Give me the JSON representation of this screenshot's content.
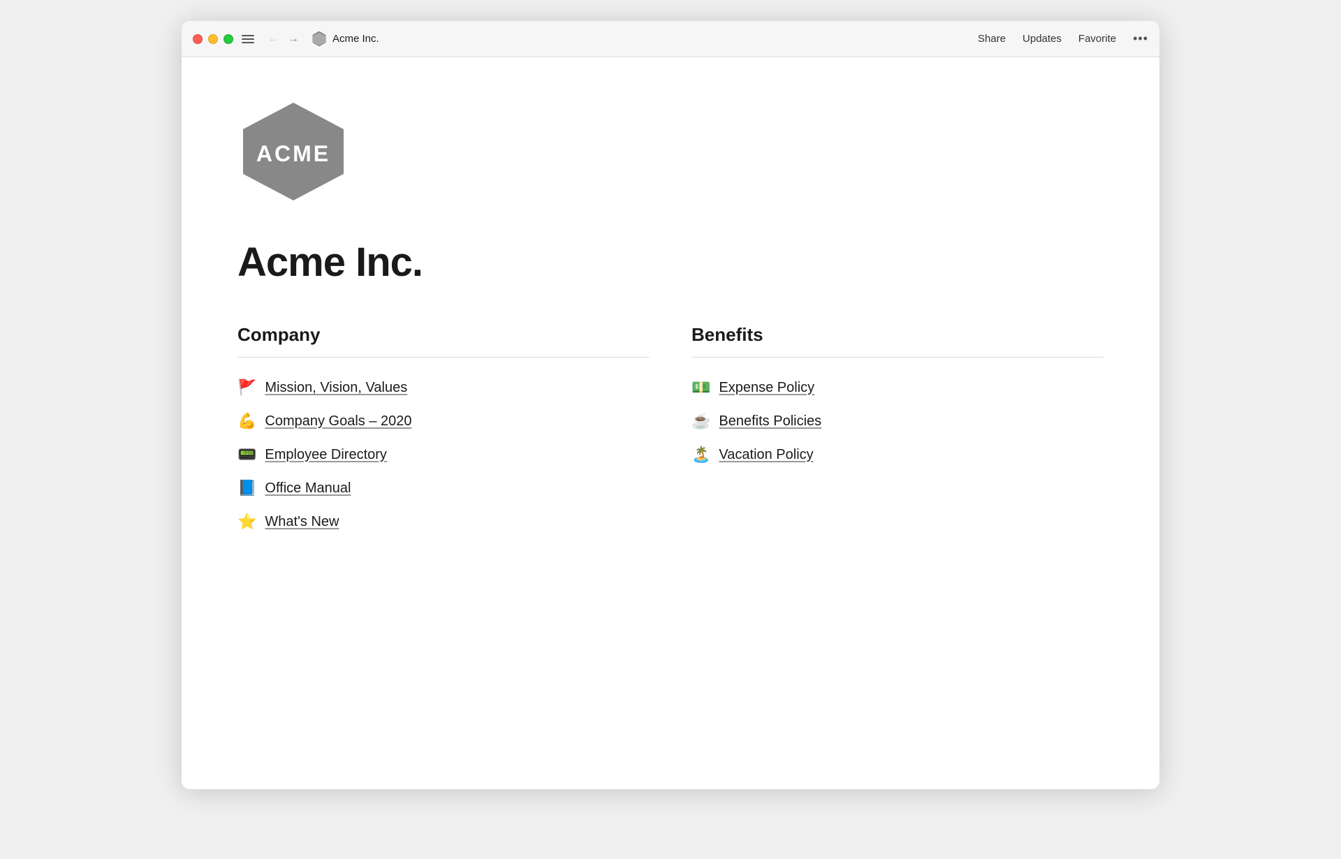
{
  "window": {
    "title": "Acme Inc.",
    "traffic_lights": {
      "close_label": "close",
      "minimize_label": "minimize",
      "maximize_label": "maximize"
    }
  },
  "titlebar": {
    "back_arrow": "←",
    "forward_arrow": "→",
    "page_title": "Acme Inc.",
    "actions": {
      "share": "Share",
      "updates": "Updates",
      "favorite": "Favorite",
      "more": "•••"
    }
  },
  "page": {
    "heading": "Acme Inc.",
    "logo_alt": "Acme Inc. Logo"
  },
  "company_section": {
    "heading": "Company",
    "items": [
      {
        "emoji": "🚩",
        "label": "Mission, Vision, Values"
      },
      {
        "emoji": "💪",
        "label": "Company Goals – 2020"
      },
      {
        "emoji": "📟",
        "label": "Employee Directory"
      },
      {
        "emoji": "📘",
        "label": "Office Manual"
      },
      {
        "emoji": "⭐",
        "label": "What's New"
      }
    ]
  },
  "benefits_section": {
    "heading": "Benefits",
    "items": [
      {
        "emoji": "💵",
        "label": "Expense Policy"
      },
      {
        "emoji": "☕",
        "label": "Benefits Policies"
      },
      {
        "emoji": "🏝️",
        "label": "Vacation Policy"
      }
    ]
  }
}
